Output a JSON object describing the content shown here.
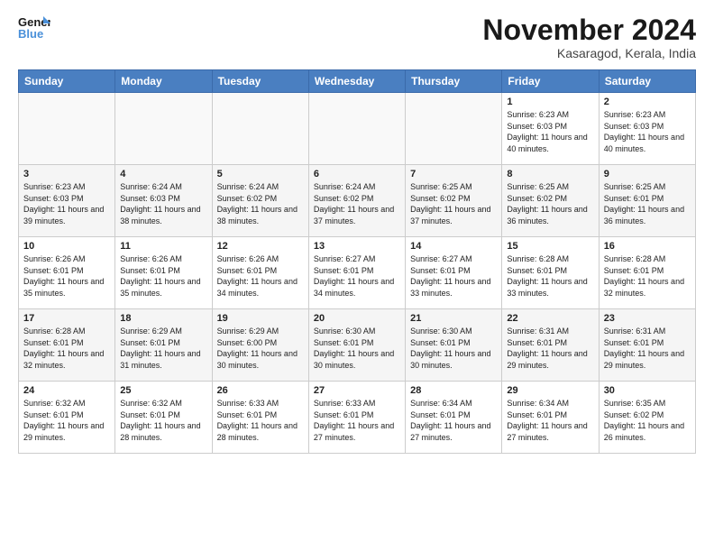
{
  "logo": {
    "line1": "General",
    "line2": "Blue"
  },
  "title": "November 2024",
  "location": "Kasaragod, Kerala, India",
  "weekdays": [
    "Sunday",
    "Monday",
    "Tuesday",
    "Wednesday",
    "Thursday",
    "Friday",
    "Saturday"
  ],
  "weeks": [
    [
      {
        "day": "",
        "info": ""
      },
      {
        "day": "",
        "info": ""
      },
      {
        "day": "",
        "info": ""
      },
      {
        "day": "",
        "info": ""
      },
      {
        "day": "",
        "info": ""
      },
      {
        "day": "1",
        "info": "Sunrise: 6:23 AM\nSunset: 6:03 PM\nDaylight: 11 hours\nand 40 minutes."
      },
      {
        "day": "2",
        "info": "Sunrise: 6:23 AM\nSunset: 6:03 PM\nDaylight: 11 hours\nand 40 minutes."
      }
    ],
    [
      {
        "day": "3",
        "info": "Sunrise: 6:23 AM\nSunset: 6:03 PM\nDaylight: 11 hours\nand 39 minutes."
      },
      {
        "day": "4",
        "info": "Sunrise: 6:24 AM\nSunset: 6:03 PM\nDaylight: 11 hours\nand 38 minutes."
      },
      {
        "day": "5",
        "info": "Sunrise: 6:24 AM\nSunset: 6:02 PM\nDaylight: 11 hours\nand 38 minutes."
      },
      {
        "day": "6",
        "info": "Sunrise: 6:24 AM\nSunset: 6:02 PM\nDaylight: 11 hours\nand 37 minutes."
      },
      {
        "day": "7",
        "info": "Sunrise: 6:25 AM\nSunset: 6:02 PM\nDaylight: 11 hours\nand 37 minutes."
      },
      {
        "day": "8",
        "info": "Sunrise: 6:25 AM\nSunset: 6:02 PM\nDaylight: 11 hours\nand 36 minutes."
      },
      {
        "day": "9",
        "info": "Sunrise: 6:25 AM\nSunset: 6:01 PM\nDaylight: 11 hours\nand 36 minutes."
      }
    ],
    [
      {
        "day": "10",
        "info": "Sunrise: 6:26 AM\nSunset: 6:01 PM\nDaylight: 11 hours\nand 35 minutes."
      },
      {
        "day": "11",
        "info": "Sunrise: 6:26 AM\nSunset: 6:01 PM\nDaylight: 11 hours\nand 35 minutes."
      },
      {
        "day": "12",
        "info": "Sunrise: 6:26 AM\nSunset: 6:01 PM\nDaylight: 11 hours\nand 34 minutes."
      },
      {
        "day": "13",
        "info": "Sunrise: 6:27 AM\nSunset: 6:01 PM\nDaylight: 11 hours\nand 34 minutes."
      },
      {
        "day": "14",
        "info": "Sunrise: 6:27 AM\nSunset: 6:01 PM\nDaylight: 11 hours\nand 33 minutes."
      },
      {
        "day": "15",
        "info": "Sunrise: 6:28 AM\nSunset: 6:01 PM\nDaylight: 11 hours\nand 33 minutes."
      },
      {
        "day": "16",
        "info": "Sunrise: 6:28 AM\nSunset: 6:01 PM\nDaylight: 11 hours\nand 32 minutes."
      }
    ],
    [
      {
        "day": "17",
        "info": "Sunrise: 6:28 AM\nSunset: 6:01 PM\nDaylight: 11 hours\nand 32 minutes."
      },
      {
        "day": "18",
        "info": "Sunrise: 6:29 AM\nSunset: 6:01 PM\nDaylight: 11 hours\nand 31 minutes."
      },
      {
        "day": "19",
        "info": "Sunrise: 6:29 AM\nSunset: 6:00 PM\nDaylight: 11 hours\nand 30 minutes."
      },
      {
        "day": "20",
        "info": "Sunrise: 6:30 AM\nSunset: 6:01 PM\nDaylight: 11 hours\nand 30 minutes."
      },
      {
        "day": "21",
        "info": "Sunrise: 6:30 AM\nSunset: 6:01 PM\nDaylight: 11 hours\nand 30 minutes."
      },
      {
        "day": "22",
        "info": "Sunrise: 6:31 AM\nSunset: 6:01 PM\nDaylight: 11 hours\nand 29 minutes."
      },
      {
        "day": "23",
        "info": "Sunrise: 6:31 AM\nSunset: 6:01 PM\nDaylight: 11 hours\nand 29 minutes."
      }
    ],
    [
      {
        "day": "24",
        "info": "Sunrise: 6:32 AM\nSunset: 6:01 PM\nDaylight: 11 hours\nand 29 minutes."
      },
      {
        "day": "25",
        "info": "Sunrise: 6:32 AM\nSunset: 6:01 PM\nDaylight: 11 hours\nand 28 minutes."
      },
      {
        "day": "26",
        "info": "Sunrise: 6:33 AM\nSunset: 6:01 PM\nDaylight: 11 hours\nand 28 minutes."
      },
      {
        "day": "27",
        "info": "Sunrise: 6:33 AM\nSunset: 6:01 PM\nDaylight: 11 hours\nand 27 minutes."
      },
      {
        "day": "28",
        "info": "Sunrise: 6:34 AM\nSunset: 6:01 PM\nDaylight: 11 hours\nand 27 minutes."
      },
      {
        "day": "29",
        "info": "Sunrise: 6:34 AM\nSunset: 6:01 PM\nDaylight: 11 hours\nand 27 minutes."
      },
      {
        "day": "30",
        "info": "Sunrise: 6:35 AM\nSunset: 6:02 PM\nDaylight: 11 hours\nand 26 minutes."
      }
    ]
  ]
}
